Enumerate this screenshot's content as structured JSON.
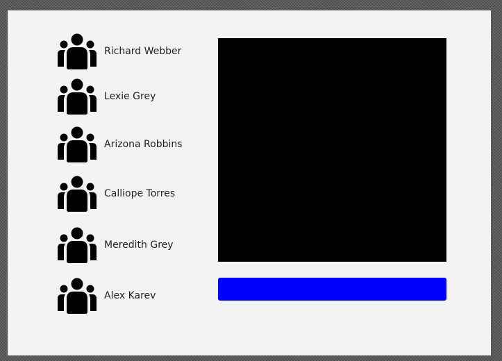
{
  "people": [
    {
      "name": "Richard Webber"
    },
    {
      "name": "Lexie Grey"
    },
    {
      "name": "Arizona Robbins"
    },
    {
      "name": "Calliope Torres"
    },
    {
      "name": "Meredith Grey"
    },
    {
      "name": "Alex Karev"
    }
  ],
  "icons": {
    "person": "people-group-icon"
  },
  "colors": {
    "panel": "#f3f3f3",
    "media": "#000000",
    "action": "#0000ff"
  }
}
